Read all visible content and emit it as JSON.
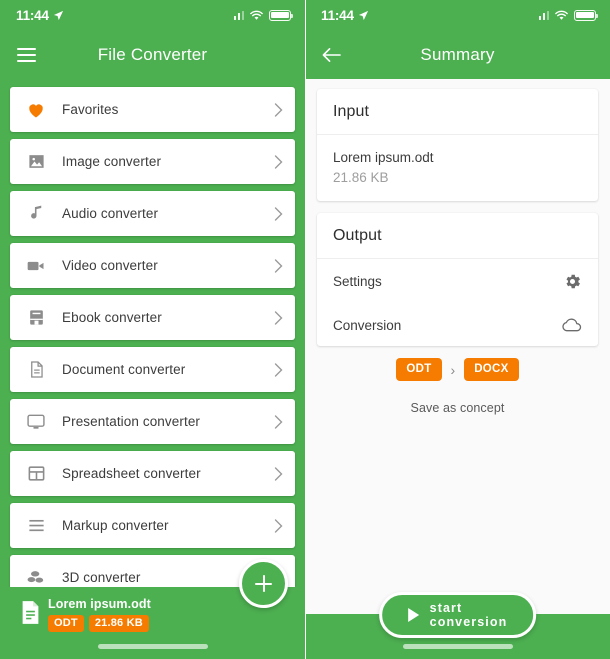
{
  "status_bar": {
    "time": "11:44",
    "location_icon": "location-arrow-icon",
    "signal_icon": "cellular-signal-icon",
    "wifi_icon": "wifi-icon",
    "battery_icon": "battery-full-icon"
  },
  "left_screen": {
    "appbar": {
      "menu_icon": "hamburger-menu-icon",
      "title": "File Converter"
    },
    "list": [
      {
        "label": "Favorites",
        "icon": "heart-icon",
        "chevron": "chevron-right-icon"
      },
      {
        "label": "Image converter",
        "icon": "image-icon",
        "chevron": "chevron-right-icon"
      },
      {
        "label": "Audio converter",
        "icon": "music-note-icon",
        "chevron": "chevron-right-icon"
      },
      {
        "label": "Video converter",
        "icon": "video-camera-icon",
        "chevron": "chevron-right-icon"
      },
      {
        "label": "Ebook converter",
        "icon": "book-icon",
        "chevron": "chevron-right-icon"
      },
      {
        "label": "Document converter",
        "icon": "document-icon",
        "chevron": "chevron-right-icon"
      },
      {
        "label": "Presentation converter",
        "icon": "monitor-icon",
        "chevron": "chevron-right-icon"
      },
      {
        "label": "Spreadsheet converter",
        "icon": "table-grid-icon",
        "chevron": "chevron-right-icon"
      },
      {
        "label": "Markup converter",
        "icon": "lines-icon",
        "chevron": "chevron-right-icon"
      },
      {
        "label": "3D converter",
        "icon": "cubes-3d-icon",
        "chevron": "chevron-right-icon"
      }
    ],
    "fab": {
      "icon": "plus-icon",
      "label": ""
    },
    "file_bar": {
      "icon": "document-file-icon",
      "file_name": "Lorem ipsum.odt",
      "format_chip": "ODT",
      "size_chip": "21.86 KB"
    }
  },
  "right_screen": {
    "appbar": {
      "back_icon": "back-arrow-icon",
      "title": "Summary"
    },
    "input_panel": {
      "title": "Input",
      "file_name": "Lorem ipsum.odt",
      "file_size": "21.86 KB"
    },
    "output_panel": {
      "title": "Output",
      "rows": [
        {
          "label": "Settings",
          "icon": "gear-icon"
        },
        {
          "label": "Conversion",
          "icon": "cloud-icon"
        }
      ]
    },
    "format_row": {
      "from": "ODT",
      "arrow": "›",
      "to": "DOCX"
    },
    "save_as_concept": "Save as concept",
    "start_button": {
      "label": "start conversion",
      "icon": "play-icon"
    }
  },
  "colors": {
    "brand_green": "#4caf50",
    "accent_orange": "#f57c00",
    "background": "#fafafa"
  }
}
